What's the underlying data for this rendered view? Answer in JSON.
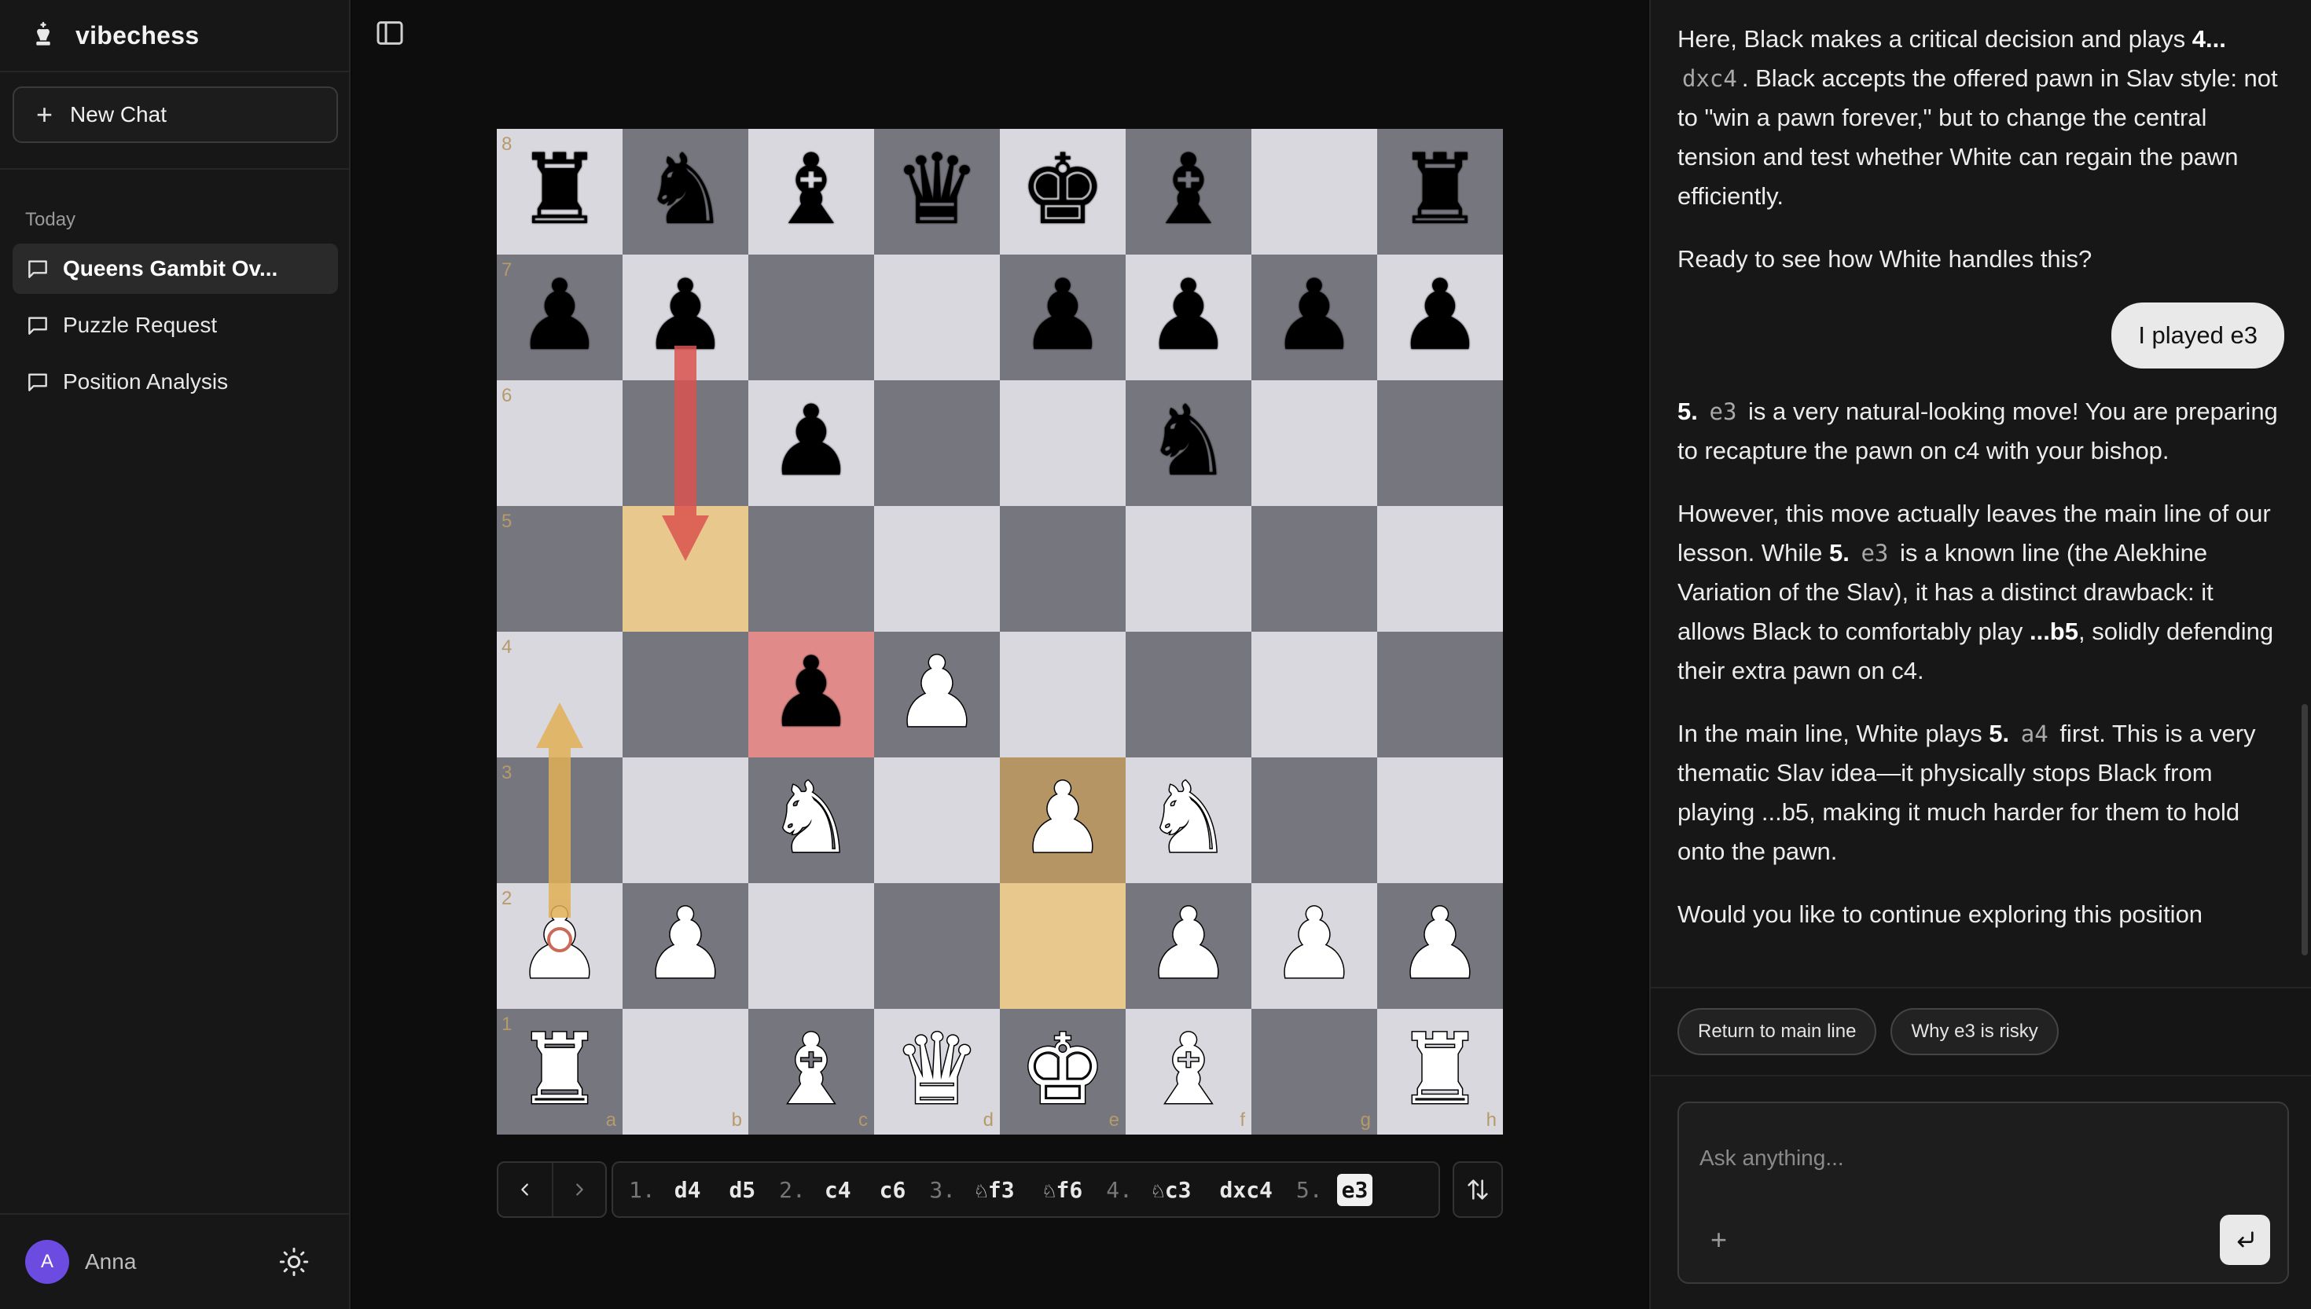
{
  "app": {
    "name": "vibechess"
  },
  "sidebar": {
    "new_chat_label": "New Chat",
    "section_label": "Today",
    "chats": [
      {
        "label": "Queens Gambit Ov...",
        "active": true
      },
      {
        "label": "Puzzle Request",
        "active": false
      },
      {
        "label": "Position Analysis",
        "active": false
      }
    ],
    "user": {
      "initial": "A",
      "name": "Anna"
    }
  },
  "board": {
    "orientation": "white",
    "ranks": [
      "8",
      "7",
      "6",
      "5",
      "4",
      "3",
      "2",
      "1"
    ],
    "files": [
      "a",
      "b",
      "c",
      "d",
      "e",
      "f",
      "g",
      "h"
    ],
    "position": [
      [
        "br",
        "bn",
        "bb",
        "bq",
        "bk",
        "bb",
        "",
        "br"
      ],
      [
        "bp",
        "bp",
        "",
        "",
        "bp",
        "bp",
        "bp",
        "bp"
      ],
      [
        "",
        "",
        "bp",
        "",
        "",
        "bn",
        "",
        ""
      ],
      [
        "",
        "",
        "",
        "",
        "",
        "",
        "",
        ""
      ],
      [
        "",
        "",
        "bp",
        "wp",
        "",
        "",
        "",
        ""
      ],
      [
        "",
        "",
        "wn",
        "",
        "wp",
        "wn",
        "",
        ""
      ],
      [
        "wp",
        "wp",
        "",
        "",
        "",
        "wp",
        "wp",
        "wp"
      ],
      [
        "wr",
        "",
        "wb",
        "wq",
        "wk",
        "wb",
        "",
        "wr"
      ]
    ],
    "highlights": {
      "b5": "yellow",
      "e2": "yellow",
      "e3": "dark-yellow",
      "c4": "red"
    },
    "arrows": [
      {
        "from": "b7",
        "to": "b5",
        "color": "#d9534f"
      },
      {
        "from": "a2",
        "to": "a4",
        "color": "#e0b057"
      }
    ]
  },
  "moves": {
    "list": [
      {
        "num": "1.",
        "white": "d4",
        "black": "d5"
      },
      {
        "num": "2.",
        "white": "c4",
        "black": "c6"
      },
      {
        "num": "3.",
        "white": "♘f3",
        "black": "♘f6"
      },
      {
        "num": "4.",
        "white": "♘c3",
        "black": "dxc4"
      },
      {
        "num": "5.",
        "white": "e3",
        "black": ""
      }
    ],
    "current": "e3"
  },
  "chat": {
    "messages": {
      "m1_a": "Here, Black makes a critical decision and plays ",
      "m1_b": "4...",
      "m1_code": "dxc4",
      "m1_c": ". Black accepts the offered pawn in Slav style: not to \"win a pawn forever,\" but to change the central tension and test whether White can regain the pawn efficiently.",
      "m2": "Ready to see how White handles this?",
      "user1": "I played e3",
      "m3_b": "5.",
      "m3_code": "e3",
      "m3_c": " is a very natural-looking move! You are preparing to recapture the pawn on c4 with your bishop.",
      "m4_a": "However, this move actually leaves the main line of our lesson. While ",
      "m4_b": "5.",
      "m4_code": "e3",
      "m4_c": " is a known line (the Alekhine Variation of the Slav), it has a distinct drawback: it allows Black to comfortably play ",
      "m4_d": "...b5",
      "m4_e": ", solidly defending their extra pawn on c4.",
      "m5_a": "In the main line, White plays ",
      "m5_b": "5.",
      "m5_code": "a4",
      "m5_c": " first. This is a very thematic Slav idea—it physically stops Black from playing ...b5, making it much harder for them to hold onto the pawn.",
      "m6": "Would you like to continue exploring this position"
    },
    "suggestions": [
      "Return to main line",
      "Why e3 is risky"
    ],
    "composer_placeholder": "Ask anything..."
  }
}
